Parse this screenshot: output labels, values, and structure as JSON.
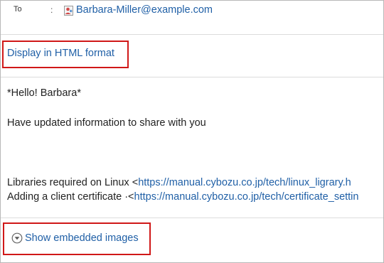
{
  "header": {
    "to_label": "To",
    "to_separator": ":",
    "to_address": "Barbara-Miller@example.com"
  },
  "format": {
    "html_link": "Display in HTML format"
  },
  "message": {
    "greeting": "*Hello! Barbara*",
    "intro": "Have updated information to share with you",
    "lines": [
      {
        "prefix": "Libraries required on Linux <",
        "link": "https://manual.cybozu.co.jp/tech/linux_ligrary.h"
      },
      {
        "prefix": "Adding a client certificate ·<",
        "link": "https://manual.cybozu.co.jp/tech/certificate_settin"
      }
    ]
  },
  "embedded": {
    "show_images_label": "Show embedded images",
    "icon": "circle-chevron-down-icon"
  },
  "colors": {
    "link": "#1f5fa6",
    "highlight": "#d01818",
    "divider": "#dcdcdc",
    "text": "#222222"
  }
}
